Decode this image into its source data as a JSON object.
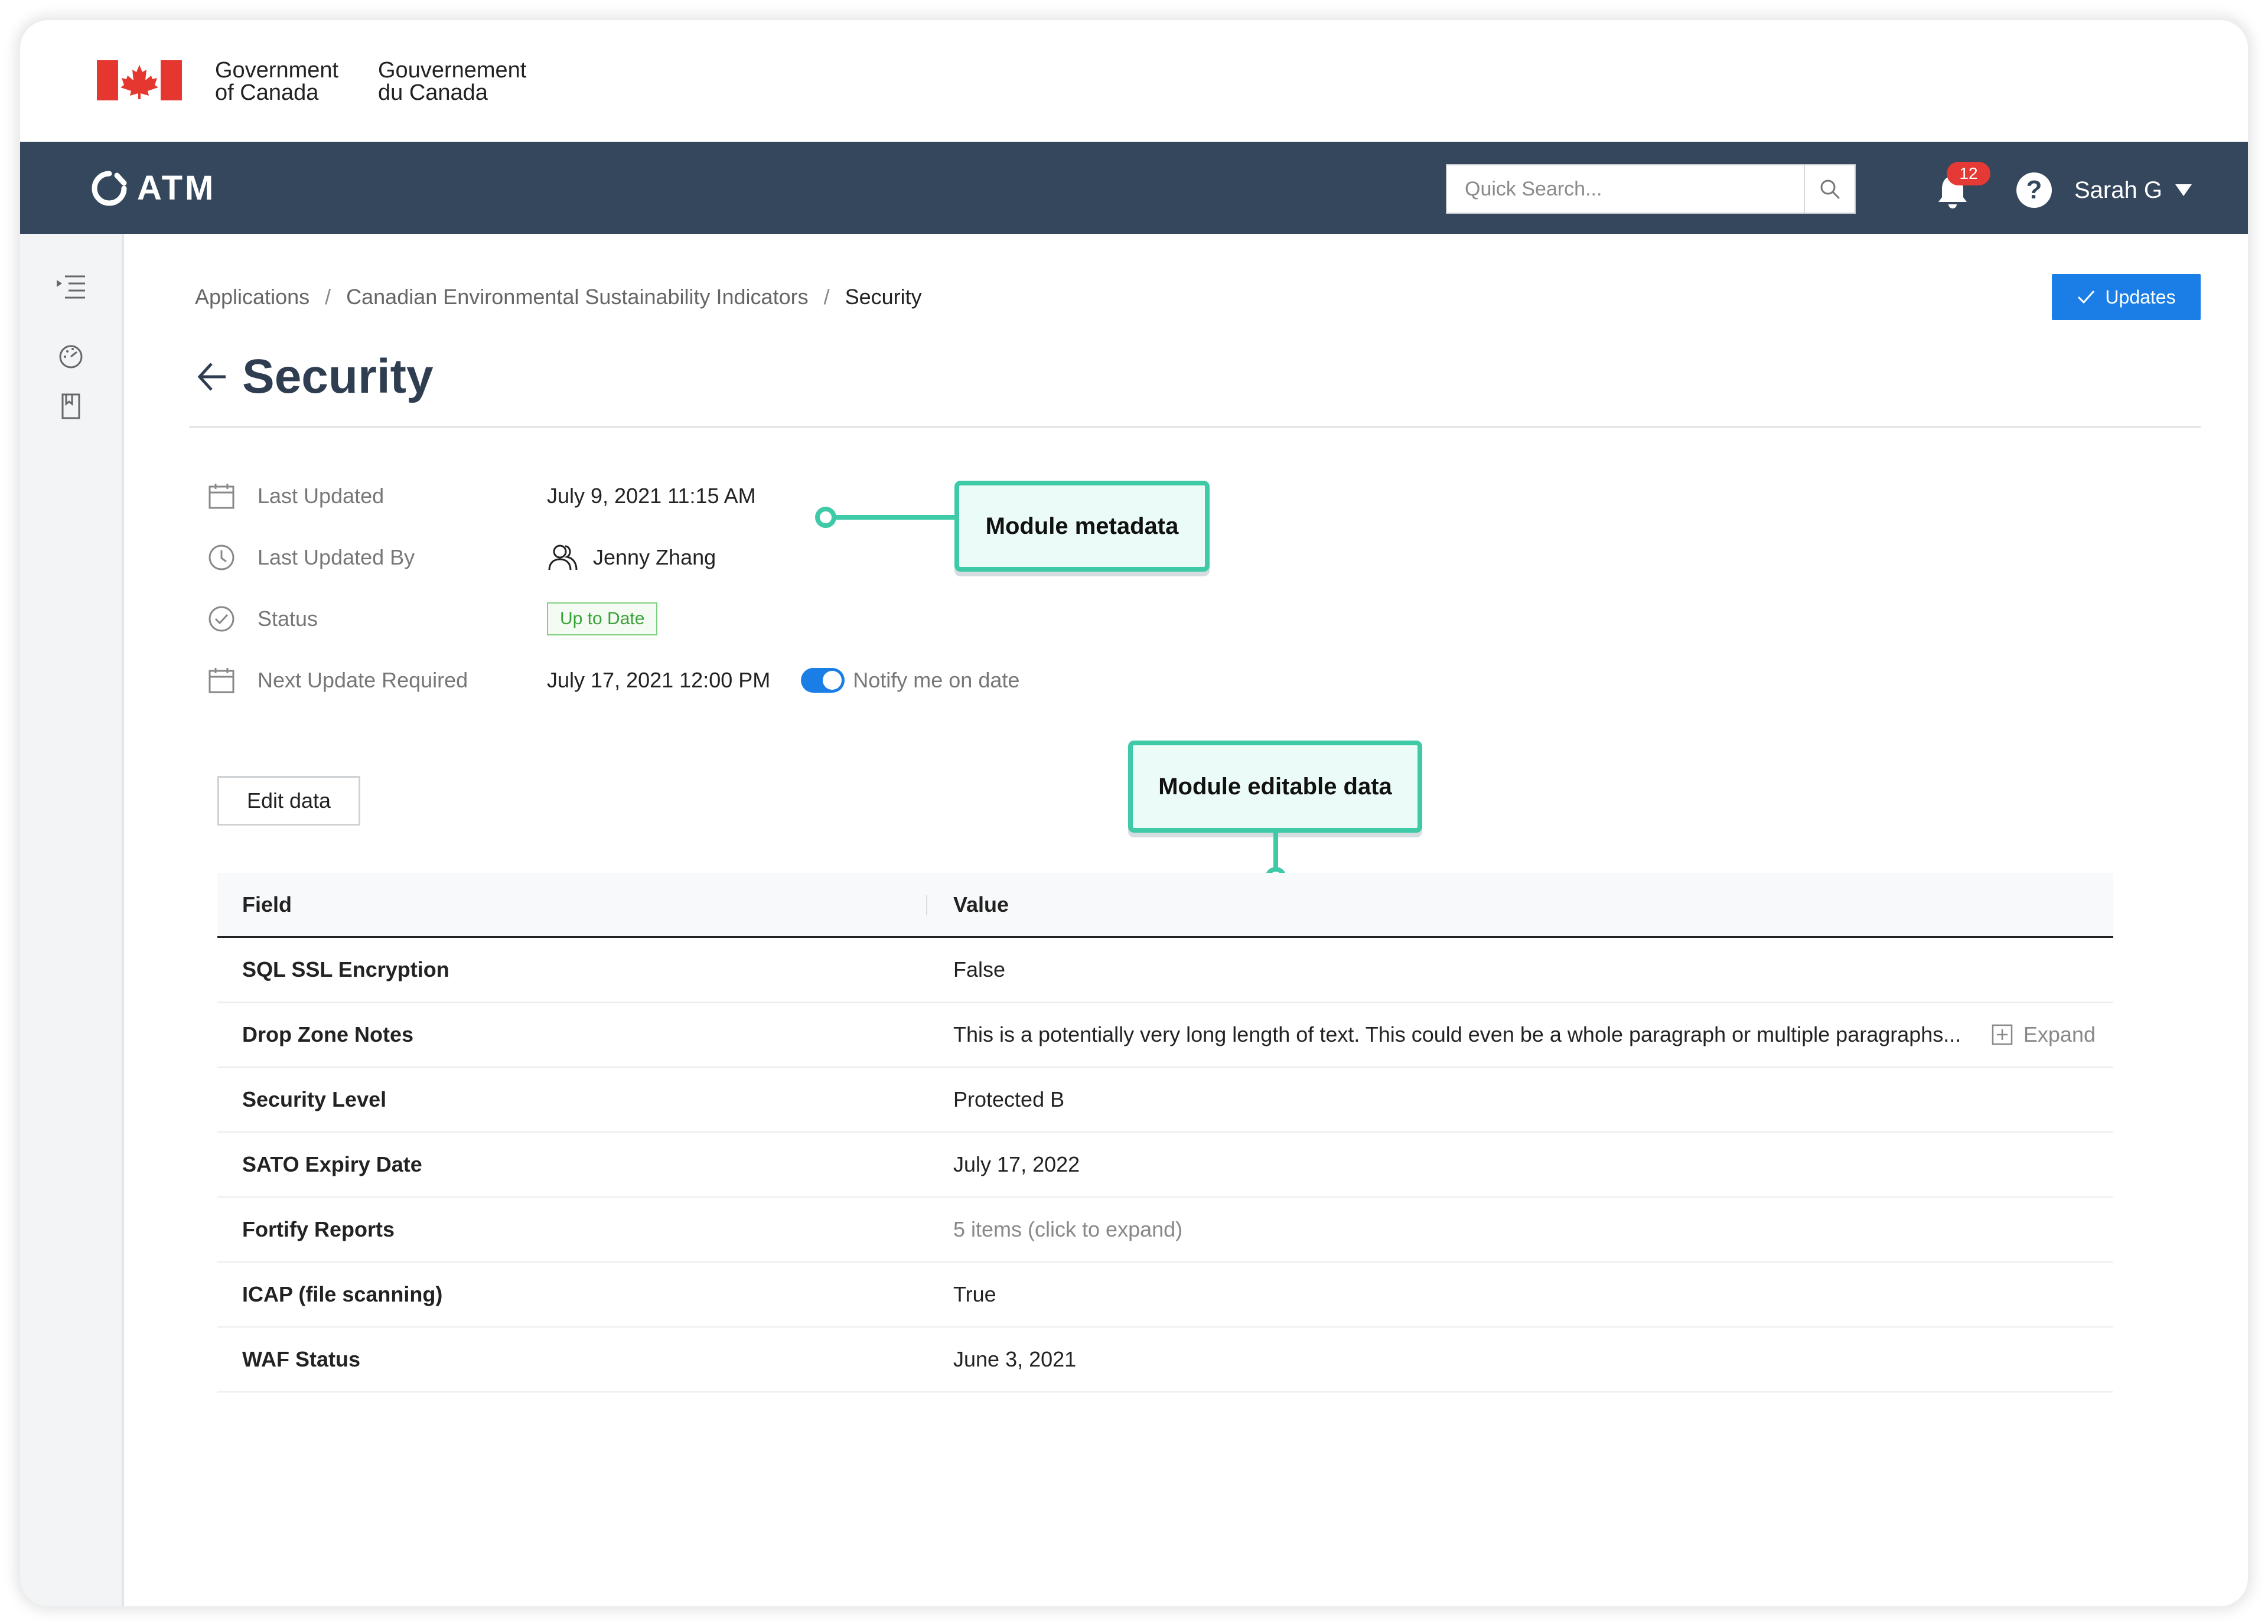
{
  "gov": {
    "en_line1": "Government",
    "en_line2": "of Canada",
    "fr_line1": "Gouvernement",
    "fr_line2": "du Canada"
  },
  "navbar": {
    "app_name": "ATM",
    "search_placeholder": "Quick Search...",
    "notification_count": "12",
    "help_label": "?",
    "user_name": "Sarah G"
  },
  "breadcrumb": {
    "items": [
      "Applications",
      "Canadian Environmental Sustainability Indicators",
      "Security"
    ],
    "separator": "/"
  },
  "updates_button": "Updates",
  "page_title": "Security",
  "metadata": {
    "last_updated_label": "Last Updated",
    "last_updated_value": "July 9, 2021 11:15 AM",
    "last_updated_by_label": "Last Updated By",
    "last_updated_by_value": "Jenny Zhang",
    "status_label": "Status",
    "status_value": "Up to Date",
    "next_update_label": "Next Update Required",
    "next_update_value": "July 17, 2021 12:00 PM",
    "notify_label": "Notify me on date",
    "notify_on": true
  },
  "callouts": {
    "metadata": "Module metadata",
    "editable": "Module editable data"
  },
  "edit_button": "Edit data",
  "table": {
    "headers": [
      "Field",
      "Value"
    ],
    "rows": [
      {
        "field": "SQL SSL Encryption",
        "value": "False"
      },
      {
        "field": "Drop Zone Notes",
        "value": "This is a potentially very long length of text. This could even be a whole paragraph or multiple paragraphs...",
        "action": "Expand"
      },
      {
        "field": "Security Level",
        "value": "Protected B"
      },
      {
        "field": "SATO Expiry Date",
        "value": "July 17, 2022"
      },
      {
        "field": "Fortify Reports",
        "value": "5 items (click to expand)"
      },
      {
        "field": "ICAP (file scanning)",
        "value": "True"
      },
      {
        "field": "WAF Status",
        "value": "June 3, 2021"
      }
    ]
  },
  "colors": {
    "navbar": "#34475c",
    "primary": "#1a7ee6",
    "callout": "#3ec9a7",
    "status_green": "#3aa33a",
    "flag_red": "#e5372f"
  }
}
